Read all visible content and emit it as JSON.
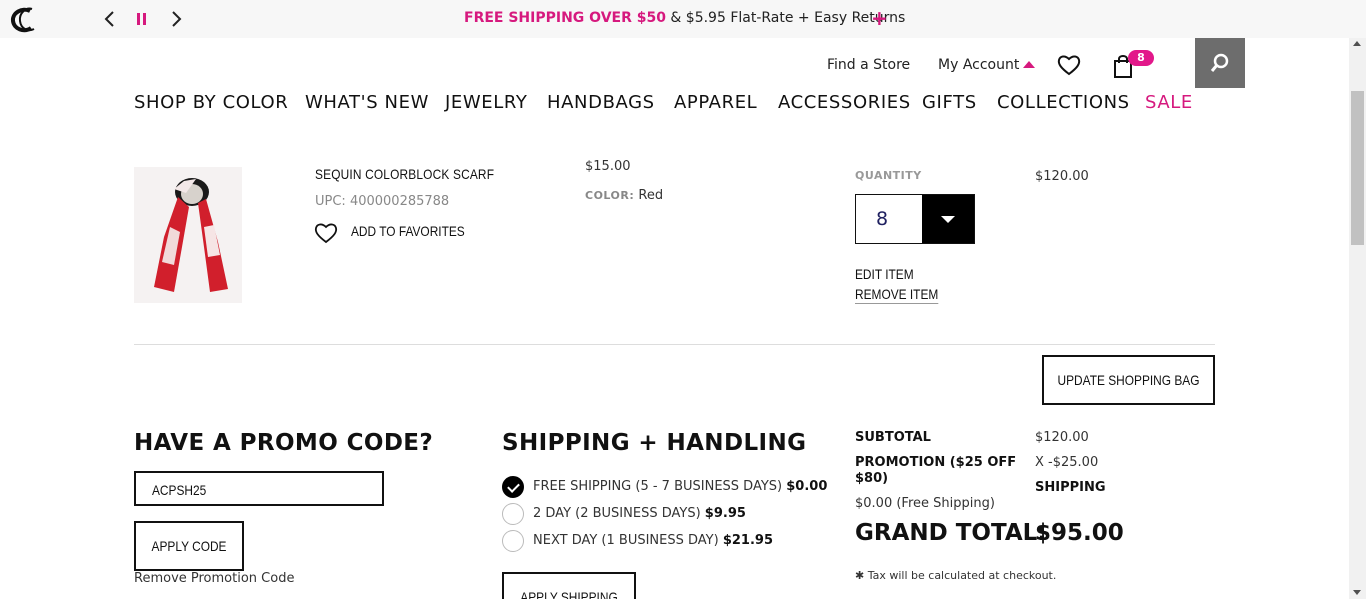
{
  "promo_bar": {
    "highlight": "FREE SHIPPING OVER $50",
    "rest": " & $5.95 Flat-Rate + Easy Returns",
    "plus": "+"
  },
  "utility_nav": {
    "find_store": "Find a Store",
    "my_account": "My Account",
    "bag_count": "8"
  },
  "main_nav": {
    "items": [
      "SHOP BY COLOR",
      "WHAT'S NEW",
      "JEWELRY",
      "HANDBAGS",
      "APPAREL",
      "ACCESSORIES",
      "GIFTS",
      "COLLECTIONS",
      "SALE"
    ]
  },
  "cart_item": {
    "name": "SEQUIN COLORBLOCK SCARF",
    "upc": "UPC: 400000285788",
    "add_favorites": "ADD TO FAVORITES",
    "price": "$15.00",
    "color_label": "COLOR:",
    "color_value": " Red",
    "quantity_label": "QUANTITY",
    "quantity": "8",
    "total": "$120.00",
    "edit": "EDIT ITEM",
    "remove": "REMOVE ITEM"
  },
  "update_bag": "UPDATE SHOPPING BAG",
  "promo_section": {
    "heading": "HAVE A PROMO CODE?",
    "code_value": "ACPSH25",
    "apply": "APPLY CODE",
    "remove": "Remove Promotion Code"
  },
  "shipping": {
    "heading": "SHIPPING + HANDLING",
    "options": [
      {
        "label": "FREE SHIPPING (5 - 7 BUSINESS DAYS)",
        "price": "$0.00",
        "selected": true
      },
      {
        "label": "2 DAY (2 BUSINESS DAYS)",
        "price": "$9.95",
        "selected": false
      },
      {
        "label": "NEXT DAY (1 BUSINESS DAY)",
        "price": "$21.95",
        "selected": false
      }
    ],
    "apply": "APPLY SHIPPING"
  },
  "summary": {
    "subtotal_label": "SUBTOTAL",
    "subtotal_value": "$120.00",
    "promotion_label": "PROMOTION ($25 OFF $80)",
    "promotion_value": "X -$25.00",
    "shipping_label": "SHIPPING",
    "shipping_value": "$0.00 (Free Shipping)",
    "grand_label": "GRAND TOTAL:",
    "grand_value": "$95.00",
    "tax_note": "Tax will be calculated at checkout."
  },
  "colors": {
    "accent": "#d6197e",
    "search_bg": "#6d6d6d"
  },
  "icons": [
    "logo",
    "chevron-left-icon",
    "pause-icon",
    "chevron-right-icon",
    "heart-icon",
    "shopping-bag-icon",
    "search-icon"
  ]
}
